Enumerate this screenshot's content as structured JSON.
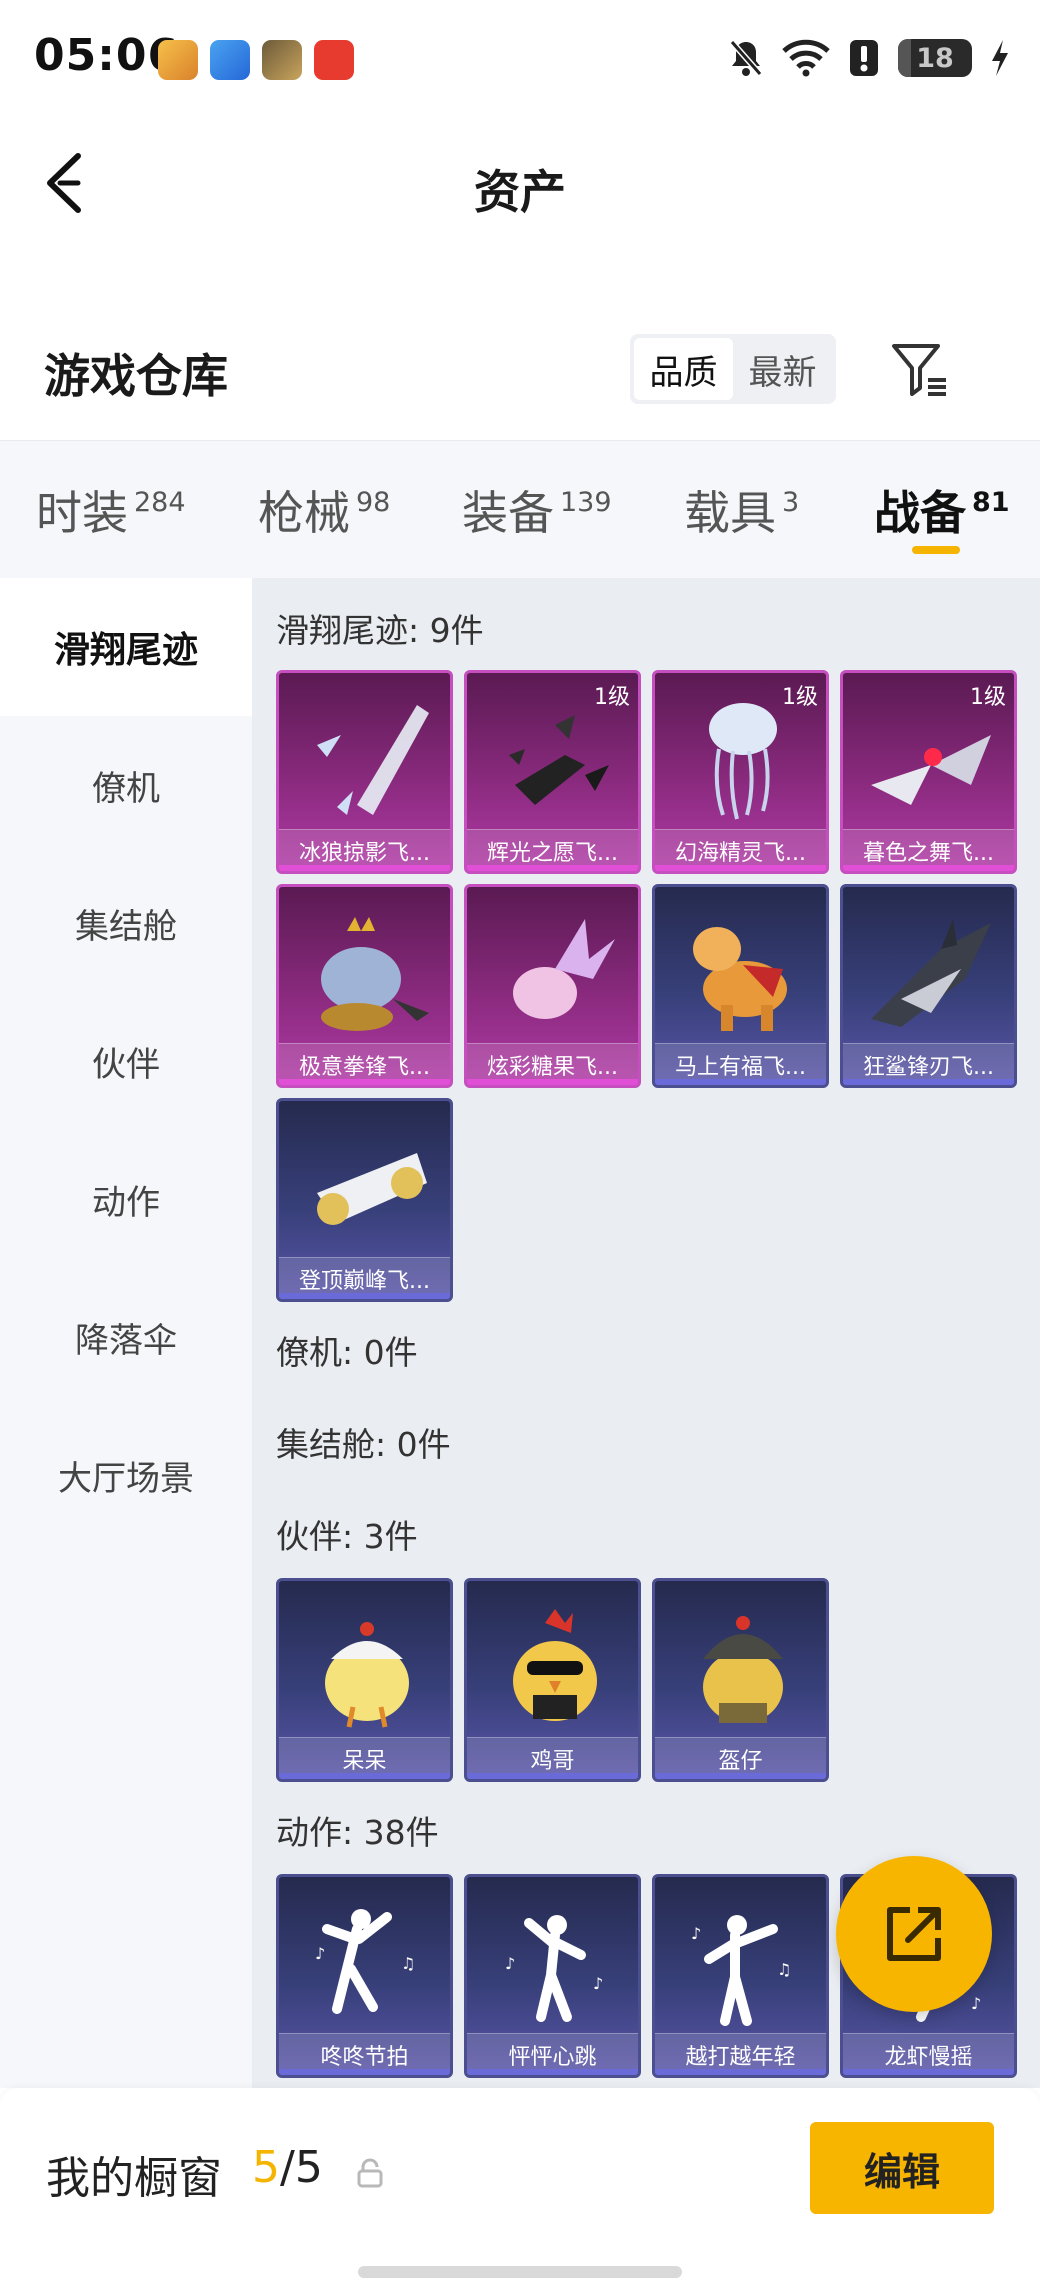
{
  "status_bar": {
    "time": "05:06",
    "battery": "18",
    "battery_level": 0.18,
    "icons": [
      "mute-bell-icon",
      "wifi-icon",
      "alert-icon",
      "battery-icon",
      "charging-icon"
    ]
  },
  "header": {
    "title": "资产"
  },
  "warehouse": {
    "title": "游戏仓库",
    "sort_options": [
      "品质",
      "最新"
    ],
    "selected_sort": "品质"
  },
  "tabs": [
    {
      "label": "时装",
      "count": "284"
    },
    {
      "label": "枪械",
      "count": "98"
    },
    {
      "label": "装备",
      "count": "139"
    },
    {
      "label": "载具",
      "count": "3"
    },
    {
      "label": "战备",
      "count": "81"
    }
  ],
  "active_tab": "战备",
  "sidebar": {
    "items": [
      "滑翔尾迹",
      "僚机",
      "集结舱",
      "伙伴",
      "动作",
      "降落伞",
      "大厅场景"
    ],
    "active": "滑翔尾迹"
  },
  "content": {
    "groups": [
      {
        "label": "滑翔尾迹: 9件",
        "items": [
          {
            "name": "冰狼掠影飞...",
            "level": "",
            "rarity": "purple"
          },
          {
            "name": "辉光之愿飞...",
            "level": "1级",
            "rarity": "purple"
          },
          {
            "name": "幻海精灵飞...",
            "level": "1级",
            "rarity": "purple"
          },
          {
            "name": "暮色之舞飞...",
            "level": "1级",
            "rarity": "purple"
          },
          {
            "name": "极意拳锋飞...",
            "level": "",
            "rarity": "purple"
          },
          {
            "name": "炫彩糖果飞...",
            "level": "",
            "rarity": "purple"
          },
          {
            "name": "马上有福飞...",
            "level": "",
            "rarity": "blue"
          },
          {
            "name": "狂鲨锋刃飞...",
            "level": "",
            "rarity": "blue"
          },
          {
            "name": "登顶巅峰飞...",
            "level": "",
            "rarity": "blue"
          }
        ]
      },
      {
        "label": "僚机: 0件",
        "items": []
      },
      {
        "label": "集结舱: 0件",
        "items": []
      },
      {
        "label": "伙伴: 3件",
        "items": [
          {
            "name": "呆呆",
            "level": "",
            "rarity": "blue"
          },
          {
            "name": "鸡哥",
            "level": "",
            "rarity": "blue"
          },
          {
            "name": "盔仔",
            "level": "",
            "rarity": "blue"
          }
        ]
      },
      {
        "label": "动作: 38件",
        "items": [
          {
            "name": "咚咚节拍",
            "level": "",
            "rarity": "blue"
          },
          {
            "name": "怦怦心跳",
            "level": "",
            "rarity": "blue"
          },
          {
            "name": "越打越年轻",
            "level": "",
            "rarity": "blue"
          },
          {
            "name": "龙虾慢摇",
            "level": "",
            "rarity": "blue"
          }
        ]
      }
    ]
  },
  "bottom_bar": {
    "label": "我的橱窗",
    "current": "5",
    "separator": "/",
    "total": "5",
    "edit_label": "编辑"
  },
  "colors": {
    "accent": "#f7b500",
    "purple_rarity": "#b03aa6",
    "blue_rarity": "#5a55a8"
  }
}
